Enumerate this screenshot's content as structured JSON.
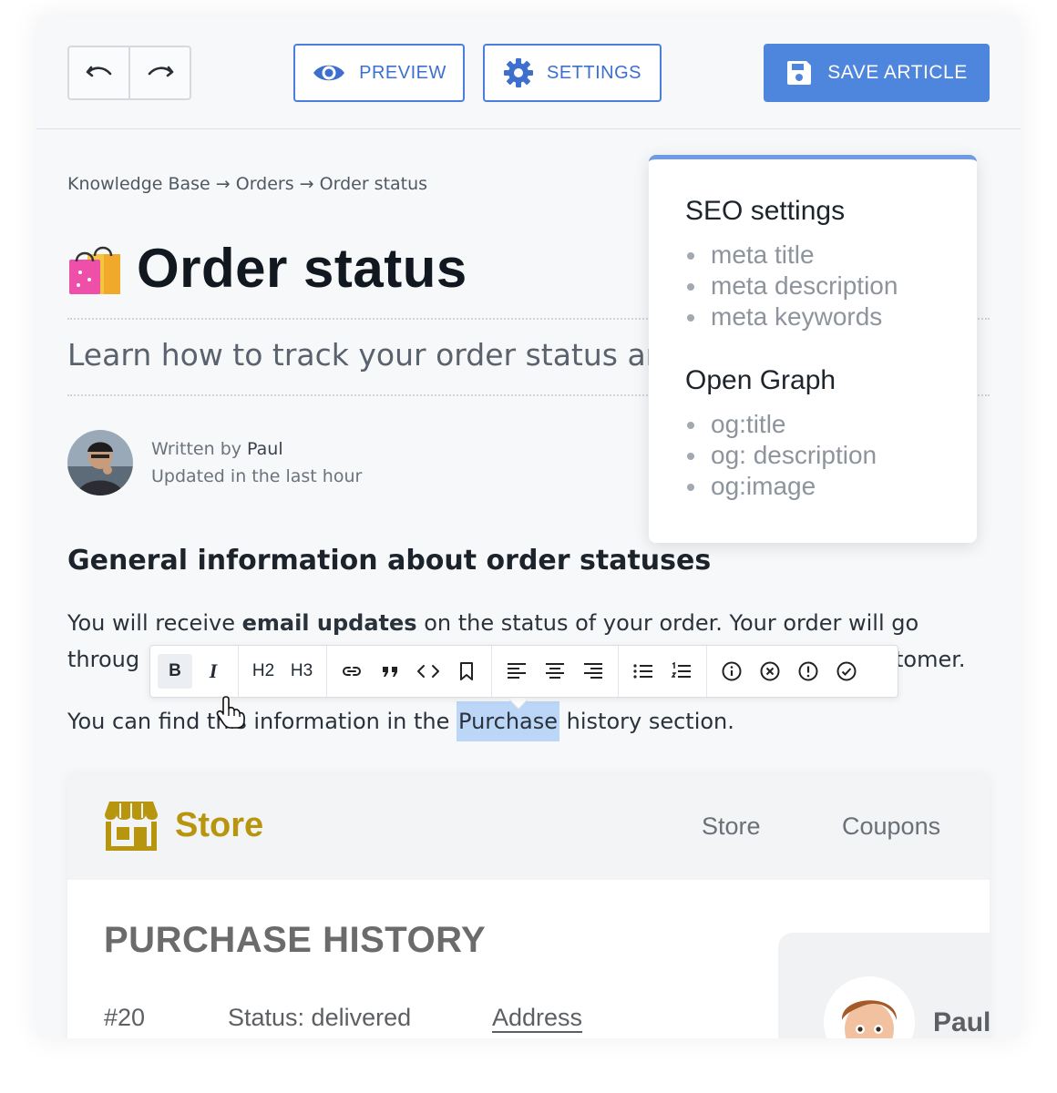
{
  "toolbar": {
    "undo_icon": "undo-icon",
    "redo_icon": "redo-icon",
    "preview_label": "PREVIEW",
    "settings_label": "SETTINGS",
    "save_label": "SAVE ARTICLE",
    "accent_color": "#4f86dd"
  },
  "article": {
    "breadcrumb": "Knowledge Base → Orders → Order status",
    "title_emoji": "shopping-bags",
    "title": "Order status",
    "subtitle": "Learn how to track your order status an",
    "author_prefix": "Written by",
    "author_name": "Paul",
    "updated": "Updated in the last hour",
    "section_heading": "General information about order statuses",
    "para1_before": "You will receive ",
    "para1_bold": "email updates",
    "para1_after": " on the status of your order. Your order will go",
    "para2_start": "throug",
    "para2_end": "tomer.",
    "para3_before": "You can find this information in the ",
    "para3_selected": "Purchase",
    "para3_after": " history section."
  },
  "format_toolbar": {
    "bold": "B",
    "italic": "I",
    "h2": "H2",
    "h3": "H3",
    "icons": [
      "link-icon",
      "quote-icon",
      "code-icon",
      "bookmark-icon",
      "align-left-icon",
      "align-center-icon",
      "align-right-icon",
      "bullet-list-icon",
      "numbered-list-icon",
      "info-icon",
      "error-icon",
      "warning-icon",
      "success-icon"
    ]
  },
  "seo_popover": {
    "seo_heading": "SEO settings",
    "seo_items": [
      "meta title",
      "meta description",
      "meta keywords"
    ],
    "og_heading": "Open Graph",
    "og_items": [
      "og:title",
      "og: description",
      "og:image"
    ]
  },
  "store": {
    "name": "Store",
    "brand_color": "#b8950e",
    "nav": [
      "Store",
      "Coupons"
    ],
    "heading": "PURCHASE HISTORY",
    "order_id": "#20",
    "status": "Status: delivered",
    "address": "Address",
    "profile_name": "Paul"
  }
}
